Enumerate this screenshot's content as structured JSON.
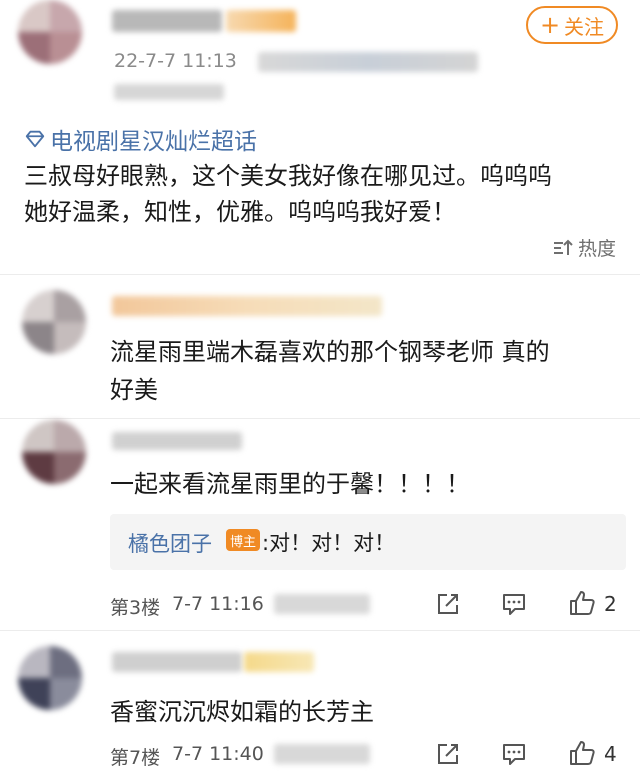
{
  "post": {
    "timestamp": "22-7-7 11:13",
    "follow_label": "关注",
    "topic": "电视剧星汉灿烂超话",
    "text_line1": "三叔母好眼熟，这个美女我好像在哪见过。呜呜呜",
    "text_line2": "她好温柔，知性，优雅。呜呜呜我好爱！",
    "sort_label": "热度"
  },
  "comments": [
    {
      "text_line1": "流星雨里端木磊喜欢的那个钢琴老师 真的",
      "text_line2": "好美"
    },
    {
      "text": "一起来看流星雨里的于馨！！！！",
      "reply": {
        "author": "橘色团子",
        "badge": "博主",
        "text": ":对！对！对！"
      },
      "floor": "第3楼",
      "time": "7-7 11:16",
      "likes": "2"
    },
    {
      "text": "香蜜沉沉烬如霜的长芳主",
      "floor": "第7楼",
      "time": "7-7 11:40",
      "likes": "4"
    }
  ],
  "colors": {
    "accent": "#f08a24",
    "link": "#4a72a8",
    "muted": "#8a8a8a"
  },
  "icons": [
    "diamond-icon",
    "sort-icon",
    "share-icon",
    "comment-icon",
    "like-icon",
    "plus-icon"
  ]
}
